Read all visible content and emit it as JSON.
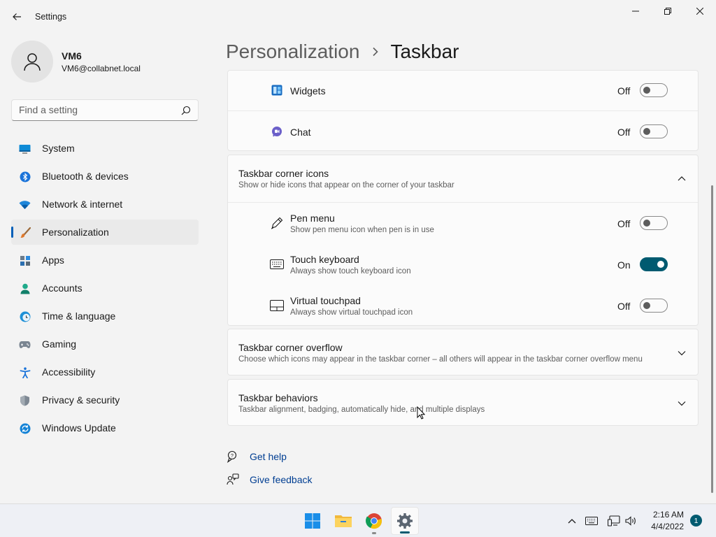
{
  "window": {
    "title": "Settings"
  },
  "user": {
    "name": "VM6",
    "email": "VM6@collabnet.local"
  },
  "search": {
    "placeholder": "Find a setting"
  },
  "sidebar": {
    "items": [
      {
        "label": "System",
        "icon": "system-icon"
      },
      {
        "label": "Bluetooth & devices",
        "icon": "bluetooth-icon"
      },
      {
        "label": "Network & internet",
        "icon": "wifi-icon"
      },
      {
        "label": "Personalization",
        "icon": "brush-icon",
        "active": true
      },
      {
        "label": "Apps",
        "icon": "apps-icon"
      },
      {
        "label": "Accounts",
        "icon": "accounts-icon"
      },
      {
        "label": "Time & language",
        "icon": "clock-globe-icon"
      },
      {
        "label": "Gaming",
        "icon": "gamepad-icon"
      },
      {
        "label": "Accessibility",
        "icon": "accessibility-icon"
      },
      {
        "label": "Privacy & security",
        "icon": "shield-icon"
      },
      {
        "label": "Windows Update",
        "icon": "update-icon"
      }
    ]
  },
  "header": {
    "parent": "Personalization",
    "current": "Taskbar"
  },
  "taskbar_items": [
    {
      "label": "Widgets",
      "state": "Off",
      "on": false,
      "icon": "widgets-icon"
    },
    {
      "label": "Chat",
      "state": "Off",
      "on": false,
      "icon": "chat-icon"
    }
  ],
  "corner_icons": {
    "title": "Taskbar corner icons",
    "subtitle": "Show or hide icons that appear on the corner of your taskbar",
    "expanded": true,
    "items": [
      {
        "label": "Pen menu",
        "subtitle": "Show pen menu icon when pen is in use",
        "state": "Off",
        "on": false,
        "icon": "pen-icon"
      },
      {
        "label": "Touch keyboard",
        "subtitle": "Always show touch keyboard icon",
        "state": "On",
        "on": true,
        "icon": "keyboard-icon"
      },
      {
        "label": "Virtual touchpad",
        "subtitle": "Always show virtual touchpad icon",
        "state": "Off",
        "on": false,
        "icon": "touchpad-icon"
      }
    ]
  },
  "corner_overflow": {
    "title": "Taskbar corner overflow",
    "subtitle": "Choose which icons may appear in the taskbar corner – all others will appear in the taskbar corner overflow menu"
  },
  "behaviors": {
    "title": "Taskbar behaviors",
    "subtitle": "Taskbar alignment, badging, automatically hide, and multiple displays"
  },
  "help": {
    "get_help": "Get help",
    "give_feedback": "Give feedback"
  },
  "tray": {
    "time": "2:16 AM",
    "date": "4/4/2022",
    "notifications": "1"
  },
  "colors": {
    "accent": "#005a70",
    "link": "#003e92"
  }
}
